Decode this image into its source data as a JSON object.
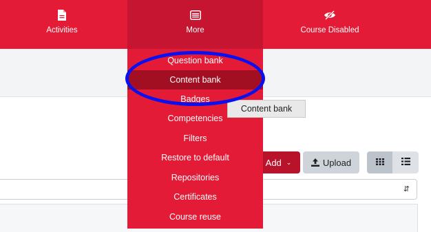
{
  "navbar": {
    "items": [
      {
        "label": "Activities",
        "icon": "document-icon"
      },
      {
        "label": "More",
        "icon": "list-window-icon"
      },
      {
        "label": "Course Disabled",
        "icon": "eye-slash-icon"
      }
    ]
  },
  "more_menu": {
    "items": [
      {
        "label": "Question bank"
      },
      {
        "label": "Content bank",
        "active": true
      },
      {
        "label": "Badges"
      },
      {
        "label": "Competencies"
      },
      {
        "label": "Filters"
      },
      {
        "label": "Restore to default"
      },
      {
        "label": "Repositories"
      },
      {
        "label": "Certificates"
      },
      {
        "label": "Course reuse"
      }
    ]
  },
  "tooltip": {
    "text": "Content bank"
  },
  "toolbar": {
    "add_label": "Add",
    "upload_label": "Upload",
    "grid_icon": "grid-view-icon",
    "list_icon": "list-view-icon"
  },
  "colors": {
    "brand_red": "#e41b36",
    "active_item": "#a30f22",
    "annotation_circle": "#0a10ee"
  }
}
